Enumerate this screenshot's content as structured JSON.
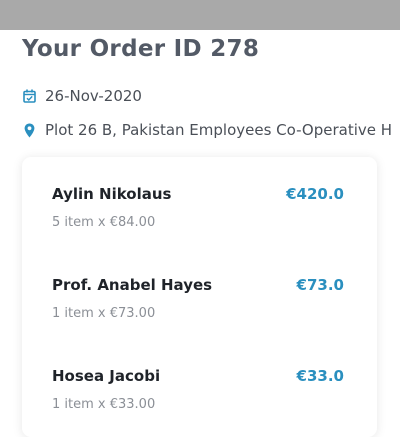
{
  "order": {
    "title": "Your Order ID 278",
    "date": "26-Nov-2020",
    "address": "Plot 26 B, Pakistan Employees Co-Operative H"
  },
  "icons": {
    "date": "calendar-check-icon",
    "address": "map-pin-icon"
  },
  "colors": {
    "accent": "#2a8fbf",
    "title": "#535a66",
    "status_bar": "#a9a9a9"
  },
  "items": [
    {
      "name": "Aylin Nikolaus",
      "price": "€420.0",
      "detail": "5 item x €84.00"
    },
    {
      "name": "Prof. Anabel Hayes",
      "price": "€73.0",
      "detail": "1 item x €73.00"
    },
    {
      "name": "Hosea Jacobi",
      "price": "€33.0",
      "detail": "1 item x €33.00"
    }
  ]
}
